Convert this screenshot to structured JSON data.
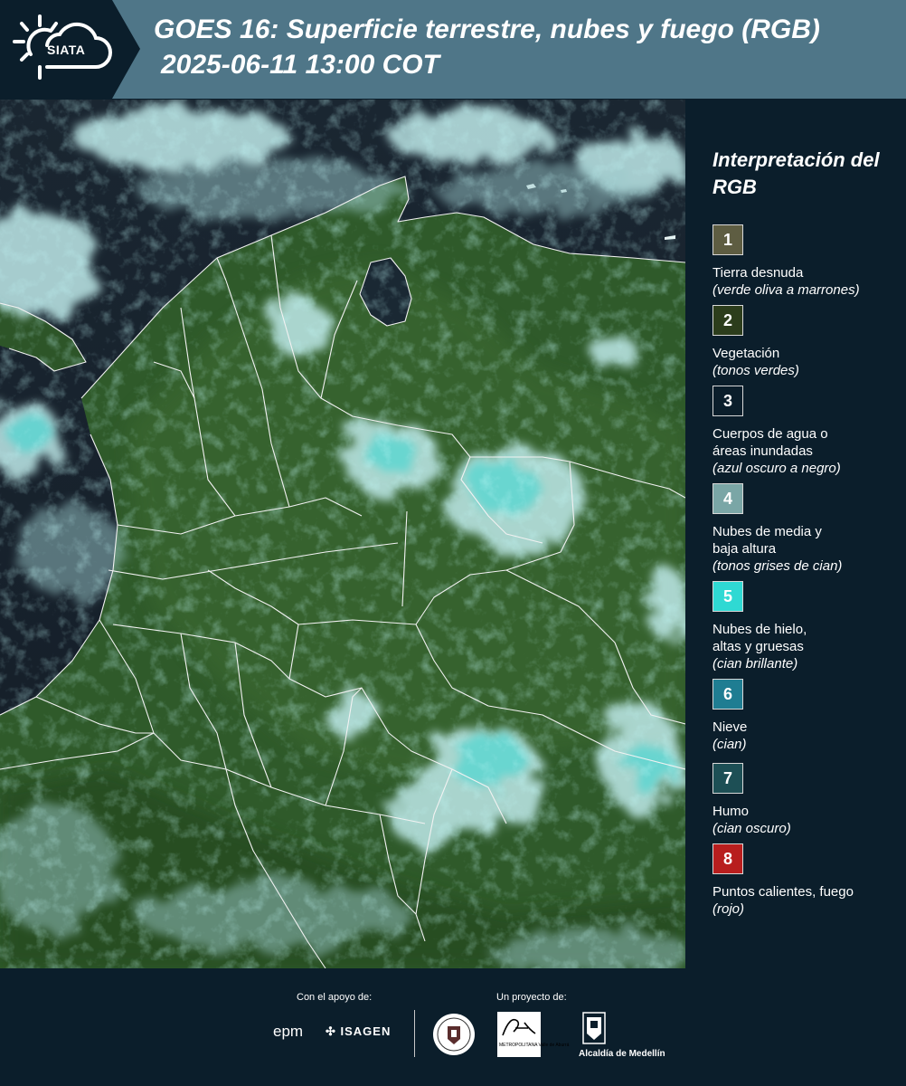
{
  "header": {
    "logo_text": "SIATA",
    "title_line1": "GOES 16: Superficie terrestre, nubes y fuego (RGB)",
    "title_line2": "2025-06-11 13:00 COT"
  },
  "legend": {
    "title": "Interpretación del RGB",
    "items": [
      {
        "num": "1",
        "label": "Tierra desnuda",
        "desc": "(verde oliva a marrones)",
        "color": "#5e5d42"
      },
      {
        "num": "2",
        "label": "Vegetación",
        "desc": "(tonos verdes)",
        "color": "#2c3d1c"
      },
      {
        "num": "3",
        "label": "Cuerpos de agua o\náreas inundadas",
        "desc": "(azul oscuro a negro)",
        "color": "#0b1e2b"
      },
      {
        "num": "4",
        "label": "Nubes de media y\nbaja altura",
        "desc": "(tonos grises de cian)",
        "color": "#7aa6a6"
      },
      {
        "num": "5",
        "label": "Nubes de hielo,\naltas y gruesas",
        "desc": "(cian brillante)",
        "color": "#2fd9d3"
      },
      {
        "num": "6",
        "label": "Nieve",
        "desc": "(cian)",
        "color": "#1f7d92"
      },
      {
        "num": "7",
        "label": "Humo",
        "desc": "(cian oscuro)",
        "color": "#1d4f55"
      },
      {
        "num": "8",
        "label": "Puntos calientes, fuego",
        "desc": "(rojo)",
        "color": "#b81e1e"
      }
    ]
  },
  "footer": {
    "support_label": "Con el apoyo de:",
    "project_label": "Un proyecto de:",
    "sponsors": [
      "epm",
      "ISAGEN"
    ],
    "area_text": "METROPOLITANA Valle de Aburrá",
    "area_script": "Área",
    "alcaldia": "Alcaldía de Medellín"
  },
  "icons": [
    "siata-sun-cloud-logo",
    "epm-logo",
    "isagen-logo",
    "university-seal-logo",
    "area-metropolitana-logo",
    "alcaldia-medellin-shield-icon"
  ]
}
